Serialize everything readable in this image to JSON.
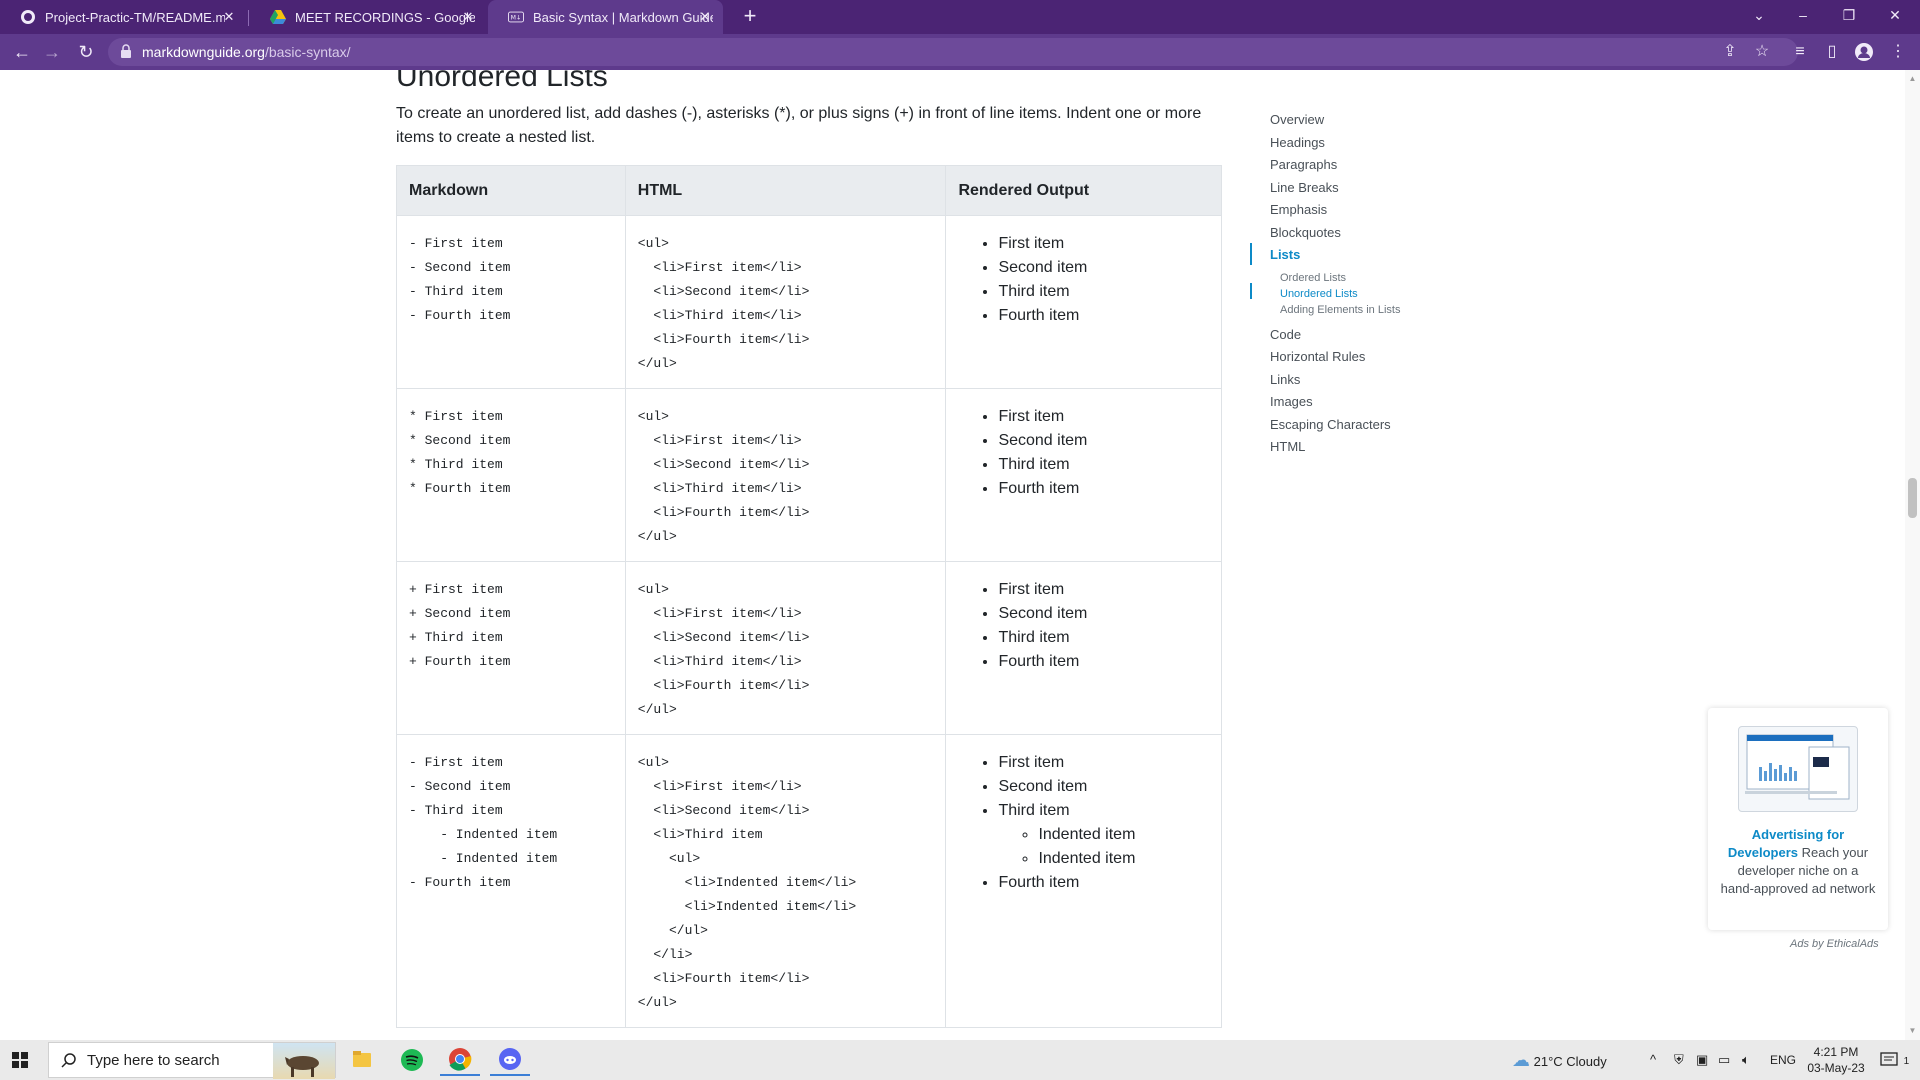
{
  "browser": {
    "tabs": [
      {
        "title": "Project-Practic-TM/README.md",
        "favicon": "github-icon",
        "active": false
      },
      {
        "title": "MEET RECORDINGS - Google Dri",
        "favicon": "google-drive-icon",
        "active": false
      },
      {
        "title": "Basic Syntax | Markdown Guide",
        "favicon": "markdown-icon",
        "active": true
      }
    ],
    "url_domain": "markdownguide.org",
    "url_path": "/basic-syntax/"
  },
  "content": {
    "heading": "Unordered Lists",
    "intro": "To create an unordered list, add dashes (-), asterisks (*), or plus signs (+) in front of line items. Indent one or more items to create a nested list.",
    "table": {
      "headers": [
        "Markdown",
        "HTML",
        "Rendered Output"
      ],
      "rows": [
        {
          "markdown": "- First item\n- Second item\n- Third item\n- Fourth item",
          "html": "<ul>\n  <li>First item</li>\n  <li>Second item</li>\n  <li>Third item</li>\n  <li>Fourth item</li>\n</ul>",
          "rendered": [
            "First item",
            "Second item",
            "Third item",
            "Fourth item"
          ]
        },
        {
          "markdown": "* First item\n* Second item\n* Third item\n* Fourth item",
          "html": "<ul>\n  <li>First item</li>\n  <li>Second item</li>\n  <li>Third item</li>\n  <li>Fourth item</li>\n</ul>",
          "rendered": [
            "First item",
            "Second item",
            "Third item",
            "Fourth item"
          ]
        },
        {
          "markdown": "+ First item\n+ Second item\n+ Third item\n+ Fourth item",
          "html": "<ul>\n  <li>First item</li>\n  <li>Second item</li>\n  <li>Third item</li>\n  <li>Fourth item</li>\n</ul>",
          "rendered": [
            "First item",
            "Second item",
            "Third item",
            "Fourth item"
          ]
        },
        {
          "markdown": "- First item\n- Second item\n- Third item\n    - Indented item\n    - Indented item\n- Fourth item",
          "html": "<ul>\n  <li>First item</li>\n  <li>Second item</li>\n  <li>Third item\n    <ul>\n      <li>Indented item</li>\n      <li>Indented item</li>\n    </ul>\n  </li>\n  <li>Fourth item</li>\n</ul>",
          "rendered_nested": {
            "before": [
              "First item",
              "Second item"
            ],
            "parent": "Third item",
            "children": [
              "Indented item",
              "Indented item"
            ],
            "after": [
              "Fourth item"
            ]
          }
        }
      ]
    }
  },
  "toc": {
    "items": [
      "Overview",
      "Headings",
      "Paragraphs",
      "Line Breaks",
      "Emphasis",
      "Blockquotes",
      "Lists"
    ],
    "subitems": [
      "Ordered Lists",
      "Unordered Lists",
      "Adding Elements in Lists"
    ],
    "items_after": [
      "Code",
      "Horizontal Rules",
      "Links",
      "Images",
      "Escaping Characters",
      "HTML"
    ]
  },
  "ad": {
    "headline": "Advertising for Developers",
    "body": "Reach your developer niche on a hand-approved ad network",
    "credit": "Ads by EthicalAds"
  },
  "taskbar": {
    "search_placeholder": "Type here to search",
    "weather": "21°C  Cloudy",
    "language": "ENG",
    "time": "4:21 PM",
    "date": "03-May-23",
    "notification_count": "1"
  },
  "colors": {
    "tab_strip": "#4b2474",
    "toolbar": "#5e3a8c",
    "accent": "#0d8ac7",
    "table_header": "#e9ecef"
  }
}
